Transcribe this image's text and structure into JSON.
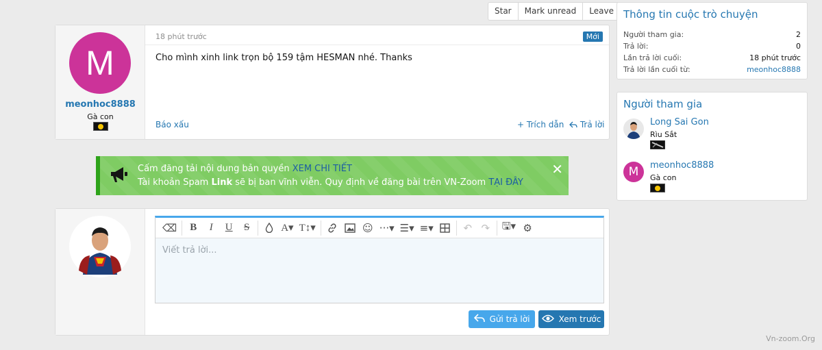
{
  "thread_actions": [
    "Star",
    "Mark unread",
    "Leave"
  ],
  "post": {
    "avatar_letter": "M",
    "username": "meonhoc8888",
    "user_title": "Gà con",
    "time": "18 phút trước",
    "new_badge": "Mới",
    "content": "Cho mình xinh link trọn bộ 159 tậm HESMAN nhé. Thanks",
    "report": "Báo xấu",
    "quote": "Trích dẫn",
    "reply": "Trả lời"
  },
  "notice": {
    "line1_text": "Cấm đăng tải nội dung bản quyền",
    "line1_link": "XEM CHI TIẾT",
    "line2_prefix": "Tài khoản Spam",
    "line2_bold": "Link",
    "line2_text": "sẽ bị ban vĩnh viễn. Quy định về đăng bài trên VN-Zoom",
    "line2_link": "TẠI ĐÂY",
    "close": "✕"
  },
  "editor": {
    "placeholder": "Viết trả lời...",
    "send_label": "Gửi trả lời",
    "preview_label": "Xem trước"
  },
  "sidebar": {
    "info": {
      "title": "Thông tin cuộc trò chuyện",
      "rows": [
        {
          "label": "Người tham gia:",
          "value": "2"
        },
        {
          "label": "Trả lời:",
          "value": "0"
        },
        {
          "label": "Lần trả lời cuối:",
          "value": "18 phút trước"
        },
        {
          "label": "Trả lời lần cuối từ:",
          "value": "meonhoc8888"
        }
      ]
    },
    "participants": {
      "title": "Người tham gia",
      "items": [
        {
          "name": "Long Sai Gon",
          "title": "Rìu Sắt"
        },
        {
          "name": "meonhoc8888",
          "title": "Gà con",
          "avatar_letter": "M"
        }
      ]
    }
  },
  "watermark": "Vn-zoom.Org",
  "colors": {
    "link": "#2577b1",
    "avatar_bg": "#cc3399",
    "notice_bg": "#7fcc63",
    "button": "#47a7eb"
  }
}
